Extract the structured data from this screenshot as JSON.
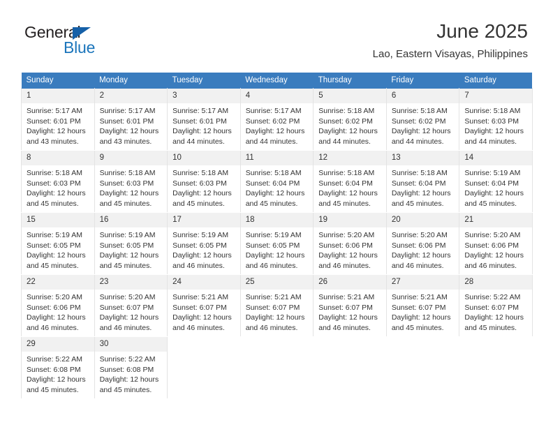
{
  "brand": {
    "name_top": "General",
    "name_bottom": "Blue",
    "accent_color": "#1b75bb",
    "triangle_color": "#1560a8"
  },
  "header": {
    "title": "June 2025",
    "subtitle": "Lao, Eastern Visayas, Philippines"
  },
  "calendar": {
    "header_bg": "#3a7cbe",
    "header_text_color": "#ffffff",
    "daynum_bg": "#f1f1f1",
    "weekday_headers": [
      "Sunday",
      "Monday",
      "Tuesday",
      "Wednesday",
      "Thursday",
      "Friday",
      "Saturday"
    ],
    "weeks": [
      [
        {
          "day": "1",
          "sunrise": "Sunrise: 5:17 AM",
          "sunset": "Sunset: 6:01 PM",
          "daylight1": "Daylight: 12 hours",
          "daylight2": "and 43 minutes."
        },
        {
          "day": "2",
          "sunrise": "Sunrise: 5:17 AM",
          "sunset": "Sunset: 6:01 PM",
          "daylight1": "Daylight: 12 hours",
          "daylight2": "and 43 minutes."
        },
        {
          "day": "3",
          "sunrise": "Sunrise: 5:17 AM",
          "sunset": "Sunset: 6:01 PM",
          "daylight1": "Daylight: 12 hours",
          "daylight2": "and 44 minutes."
        },
        {
          "day": "4",
          "sunrise": "Sunrise: 5:17 AM",
          "sunset": "Sunset: 6:02 PM",
          "daylight1": "Daylight: 12 hours",
          "daylight2": "and 44 minutes."
        },
        {
          "day": "5",
          "sunrise": "Sunrise: 5:18 AM",
          "sunset": "Sunset: 6:02 PM",
          "daylight1": "Daylight: 12 hours",
          "daylight2": "and 44 minutes."
        },
        {
          "day": "6",
          "sunrise": "Sunrise: 5:18 AM",
          "sunset": "Sunset: 6:02 PM",
          "daylight1": "Daylight: 12 hours",
          "daylight2": "and 44 minutes."
        },
        {
          "day": "7",
          "sunrise": "Sunrise: 5:18 AM",
          "sunset": "Sunset: 6:03 PM",
          "daylight1": "Daylight: 12 hours",
          "daylight2": "and 44 minutes."
        }
      ],
      [
        {
          "day": "8",
          "sunrise": "Sunrise: 5:18 AM",
          "sunset": "Sunset: 6:03 PM",
          "daylight1": "Daylight: 12 hours",
          "daylight2": "and 45 minutes."
        },
        {
          "day": "9",
          "sunrise": "Sunrise: 5:18 AM",
          "sunset": "Sunset: 6:03 PM",
          "daylight1": "Daylight: 12 hours",
          "daylight2": "and 45 minutes."
        },
        {
          "day": "10",
          "sunrise": "Sunrise: 5:18 AM",
          "sunset": "Sunset: 6:03 PM",
          "daylight1": "Daylight: 12 hours",
          "daylight2": "and 45 minutes."
        },
        {
          "day": "11",
          "sunrise": "Sunrise: 5:18 AM",
          "sunset": "Sunset: 6:04 PM",
          "daylight1": "Daylight: 12 hours",
          "daylight2": "and 45 minutes."
        },
        {
          "day": "12",
          "sunrise": "Sunrise: 5:18 AM",
          "sunset": "Sunset: 6:04 PM",
          "daylight1": "Daylight: 12 hours",
          "daylight2": "and 45 minutes."
        },
        {
          "day": "13",
          "sunrise": "Sunrise: 5:18 AM",
          "sunset": "Sunset: 6:04 PM",
          "daylight1": "Daylight: 12 hours",
          "daylight2": "and 45 minutes."
        },
        {
          "day": "14",
          "sunrise": "Sunrise: 5:19 AM",
          "sunset": "Sunset: 6:04 PM",
          "daylight1": "Daylight: 12 hours",
          "daylight2": "and 45 minutes."
        }
      ],
      [
        {
          "day": "15",
          "sunrise": "Sunrise: 5:19 AM",
          "sunset": "Sunset: 6:05 PM",
          "daylight1": "Daylight: 12 hours",
          "daylight2": "and 45 minutes."
        },
        {
          "day": "16",
          "sunrise": "Sunrise: 5:19 AM",
          "sunset": "Sunset: 6:05 PM",
          "daylight1": "Daylight: 12 hours",
          "daylight2": "and 45 minutes."
        },
        {
          "day": "17",
          "sunrise": "Sunrise: 5:19 AM",
          "sunset": "Sunset: 6:05 PM",
          "daylight1": "Daylight: 12 hours",
          "daylight2": "and 46 minutes."
        },
        {
          "day": "18",
          "sunrise": "Sunrise: 5:19 AM",
          "sunset": "Sunset: 6:05 PM",
          "daylight1": "Daylight: 12 hours",
          "daylight2": "and 46 minutes."
        },
        {
          "day": "19",
          "sunrise": "Sunrise: 5:20 AM",
          "sunset": "Sunset: 6:06 PM",
          "daylight1": "Daylight: 12 hours",
          "daylight2": "and 46 minutes."
        },
        {
          "day": "20",
          "sunrise": "Sunrise: 5:20 AM",
          "sunset": "Sunset: 6:06 PM",
          "daylight1": "Daylight: 12 hours",
          "daylight2": "and 46 minutes."
        },
        {
          "day": "21",
          "sunrise": "Sunrise: 5:20 AM",
          "sunset": "Sunset: 6:06 PM",
          "daylight1": "Daylight: 12 hours",
          "daylight2": "and 46 minutes."
        }
      ],
      [
        {
          "day": "22",
          "sunrise": "Sunrise: 5:20 AM",
          "sunset": "Sunset: 6:06 PM",
          "daylight1": "Daylight: 12 hours",
          "daylight2": "and 46 minutes."
        },
        {
          "day": "23",
          "sunrise": "Sunrise: 5:20 AM",
          "sunset": "Sunset: 6:07 PM",
          "daylight1": "Daylight: 12 hours",
          "daylight2": "and 46 minutes."
        },
        {
          "day": "24",
          "sunrise": "Sunrise: 5:21 AM",
          "sunset": "Sunset: 6:07 PM",
          "daylight1": "Daylight: 12 hours",
          "daylight2": "and 46 minutes."
        },
        {
          "day": "25",
          "sunrise": "Sunrise: 5:21 AM",
          "sunset": "Sunset: 6:07 PM",
          "daylight1": "Daylight: 12 hours",
          "daylight2": "and 46 minutes."
        },
        {
          "day": "26",
          "sunrise": "Sunrise: 5:21 AM",
          "sunset": "Sunset: 6:07 PM",
          "daylight1": "Daylight: 12 hours",
          "daylight2": "and 46 minutes."
        },
        {
          "day": "27",
          "sunrise": "Sunrise: 5:21 AM",
          "sunset": "Sunset: 6:07 PM",
          "daylight1": "Daylight: 12 hours",
          "daylight2": "and 45 minutes."
        },
        {
          "day": "28",
          "sunrise": "Sunrise: 5:22 AM",
          "sunset": "Sunset: 6:07 PM",
          "daylight1": "Daylight: 12 hours",
          "daylight2": "and 45 minutes."
        }
      ],
      [
        {
          "day": "29",
          "sunrise": "Sunrise: 5:22 AM",
          "sunset": "Sunset: 6:08 PM",
          "daylight1": "Daylight: 12 hours",
          "daylight2": "and 45 minutes."
        },
        {
          "day": "30",
          "sunrise": "Sunrise: 5:22 AM",
          "sunset": "Sunset: 6:08 PM",
          "daylight1": "Daylight: 12 hours",
          "daylight2": "and 45 minutes."
        },
        {
          "day": "",
          "sunrise": "",
          "sunset": "",
          "daylight1": "",
          "daylight2": ""
        },
        {
          "day": "",
          "sunrise": "",
          "sunset": "",
          "daylight1": "",
          "daylight2": ""
        },
        {
          "day": "",
          "sunrise": "",
          "sunset": "",
          "daylight1": "",
          "daylight2": ""
        },
        {
          "day": "",
          "sunrise": "",
          "sunset": "",
          "daylight1": "",
          "daylight2": ""
        },
        {
          "day": "",
          "sunrise": "",
          "sunset": "",
          "daylight1": "",
          "daylight2": ""
        }
      ]
    ]
  }
}
